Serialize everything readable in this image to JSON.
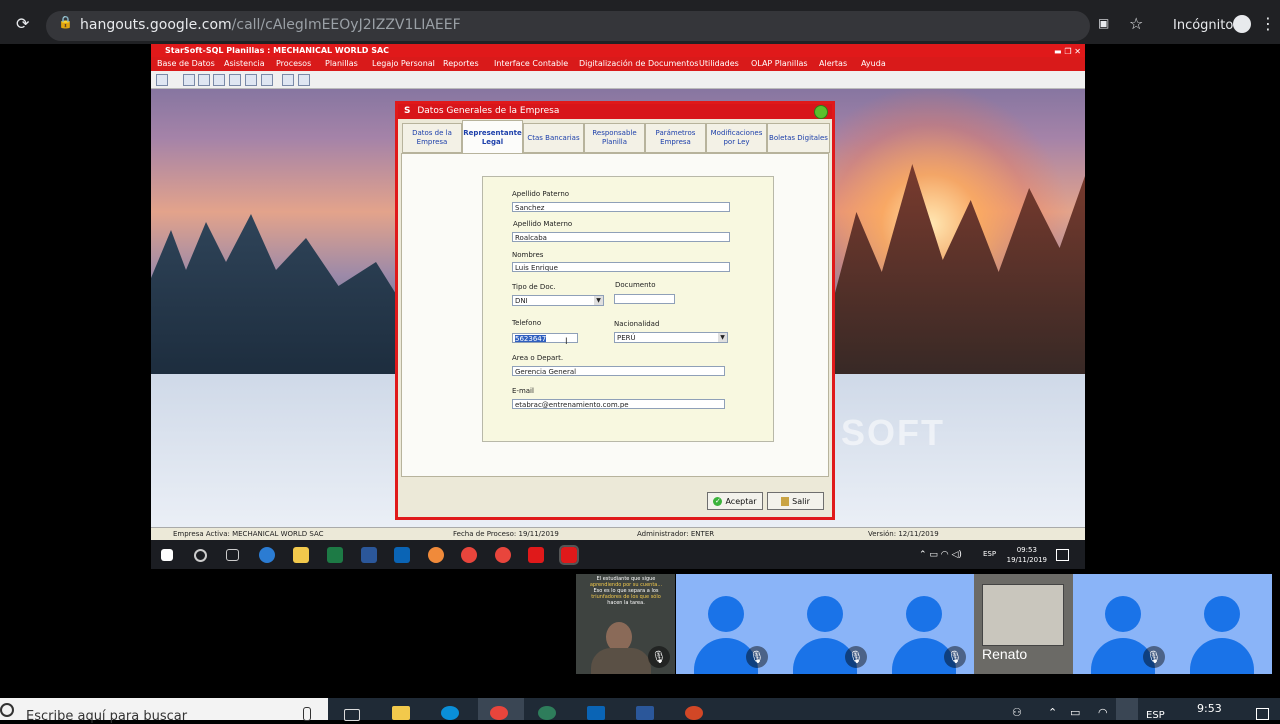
{
  "browser": {
    "url_host": "hangouts.google.com",
    "url_path": "/call/cAlegImEEOyJ2IZZV1LIAEEF",
    "incognito_label": "Incógnito",
    "icons": [
      "reload-icon",
      "lock-icon",
      "camera-blocked-icon",
      "star-icon",
      "incognito-icon",
      "menu-icon"
    ]
  },
  "app": {
    "title": "StarSoft-SQL Planillas : MECHANICAL WORLD SAC",
    "menu": [
      "Base de Datos",
      "Asistencia",
      "Procesos",
      "Planillas",
      "Legajo Personal",
      "Reportes",
      "Interface Contable",
      "Digitalización de Documentos",
      "Utilidades",
      "OLAP Planillas",
      "Alertas",
      "Ayuda"
    ],
    "watermark": "SOFT"
  },
  "dialog": {
    "title": "Datos Generales de la Empresa",
    "tabs": [
      "Datos de la Empresa",
      "Representante Legal",
      "Ctas Bancarias",
      "Responsable Planilla",
      "Parámetros Empresa",
      "Modificaciones por Ley",
      "Boletas Digitales"
    ],
    "active_tab": "Representante Legal",
    "form": {
      "apellido_paterno_label": "Apellido Paterno",
      "apellido_paterno": "Sanchez",
      "apellido_materno_label": "Apellido Materno",
      "apellido_materno": "Roalcaba",
      "nombres_label": "Nombres",
      "nombres": "Luis Enrique",
      "tipo_doc_label": "Tipo de Doc.",
      "tipo_doc": "DNI",
      "documento_label": "Documento",
      "documento": "",
      "telefono_label": "Telefono",
      "telefono": "5623647",
      "nacionalidad_label": "Nacionalidad",
      "nacionalidad": "PERÚ",
      "area_label": "Area o Depart.",
      "area": "Gerencia General",
      "email_label": "E-mail",
      "email": "etabrac@entrenamiento.com.pe"
    },
    "buttons": {
      "accept": "Aceptar",
      "exit": "Salir"
    }
  },
  "statusbar": {
    "empresa": "Empresa Activa: MECHANICAL WORLD SAC",
    "fecha": "Fecha de Proceso: 19/11/2019",
    "admin": "Administrador: ENTER",
    "version": "Versión: 12/11/2019"
  },
  "remote_taskbar": {
    "lang": "ESP",
    "time": "09:53",
    "date": "19/11/2019"
  },
  "participants": {
    "quote_line1": "El estudiante que sigue",
    "quote_line2": "aprendiendo por su cuenta...",
    "quote_line3": "Eso es lo que separa a los",
    "quote_line4": "triunfadores de los que sólo",
    "quote_line5": "hacen la tarea.",
    "renato_label": "Renato"
  },
  "win_taskbar": {
    "search_placeholder": "Escribe aquí para buscar",
    "lang": "ESP",
    "time": "9:53"
  }
}
